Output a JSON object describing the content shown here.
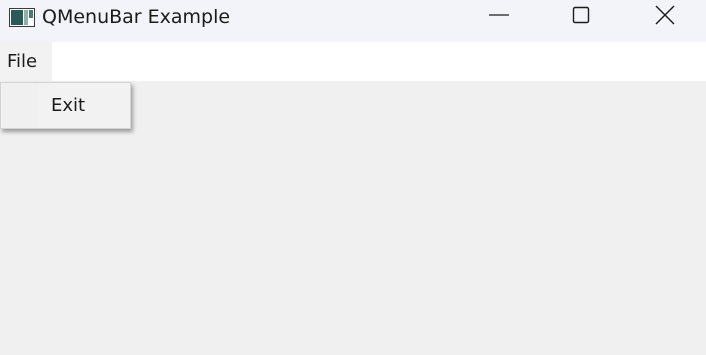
{
  "window": {
    "title": "QMenuBar Example",
    "icon": "app-window-icon",
    "caption_buttons": [
      "minimize-icon",
      "maximize-icon",
      "close-icon"
    ]
  },
  "menubar": {
    "items": [
      {
        "label": "File",
        "open": true
      }
    ]
  },
  "file_menu": {
    "items": [
      {
        "label": "Exit"
      }
    ]
  },
  "colors": {
    "titlebar": "#f3f4f9",
    "menubar": "#ffffff",
    "client": "#f0f0f0",
    "text": "#1b1b1b"
  }
}
